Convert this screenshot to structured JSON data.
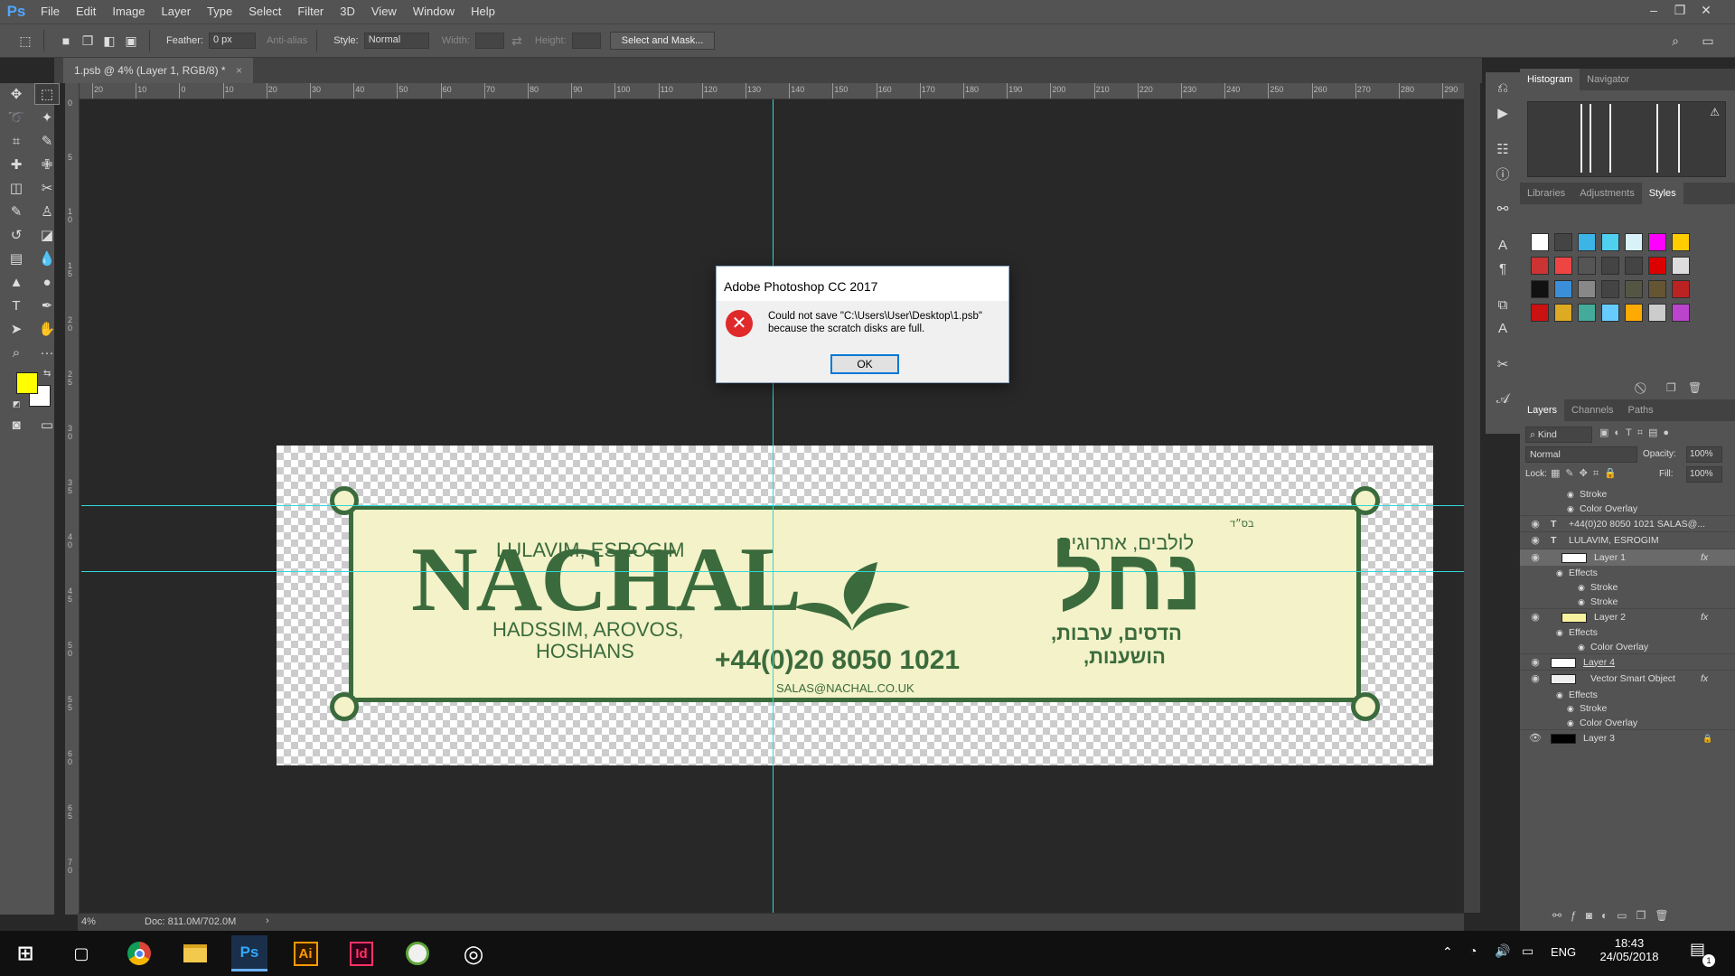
{
  "menubar": {
    "logo": "Ps",
    "items": [
      "File",
      "Edit",
      "Image",
      "Layer",
      "Type",
      "Select",
      "Filter",
      "3D",
      "View",
      "Window",
      "Help"
    ]
  },
  "options": {
    "feather_label": "Feather:",
    "feather_value": "0 px",
    "antialias_label": "Anti-alias",
    "style_label": "Style:",
    "style_value": "Normal",
    "width_label": "Width:",
    "height_label": "Height:",
    "select_mask_label": "Select and Mask..."
  },
  "document": {
    "tab_title": "1.psb @ 4% (Layer 1, RGB/8) *",
    "zoom": "4%",
    "doc_size": "Doc: 811.0M/702.0M",
    "ruler_top": [
      "20",
      "10",
      "0",
      "10",
      "20",
      "30",
      "40",
      "50",
      "60",
      "70",
      "80",
      "90",
      "100",
      "110",
      "120",
      "130",
      "140",
      "150",
      "160",
      "170",
      "180",
      "190",
      "200",
      "210",
      "220",
      "230",
      "240",
      "250",
      "260",
      "270",
      "280",
      "290"
    ],
    "ruler_left": [
      "0",
      "5",
      "1 0",
      "1 5",
      "2 0",
      "2 5",
      "3 0",
      "3 5",
      "4 0",
      "4 5",
      "5 0",
      "5 5",
      "6 0",
      "6 5",
      "7 0"
    ]
  },
  "artwork": {
    "english_top": "LULAVIM, ESROGIM",
    "brand_en": "NACHAL",
    "english_bottom_1": "HADSSIM, AROVOS,",
    "english_bottom_2": "HOSHANS",
    "phone": "+44(0)20 8050 1021",
    "email": "SALAS@NACHAL.CO.UK",
    "brand_he": "נחל",
    "hebrew_top": "לולבים, אתרוגים",
    "hebrew_bottom_1": "הדסים, ערבות,",
    "hebrew_bottom_2": "הושענות,",
    "bsd": "בס״ד",
    "colors": {
      "banner_fill": "#f3f2c8",
      "banner_green": "#3b6b3d"
    }
  },
  "dialog": {
    "title": "Adobe Photoshop CC 2017",
    "message_1": "Could not save \"C:\\Users\\User\\Desktop\\1.psb\"",
    "message_2": "because the scratch disks are full.",
    "ok_label": "OK",
    "icon": "error-icon"
  },
  "panels": {
    "top_tabs": [
      "Histogram",
      "Navigator"
    ],
    "mid_tabs": [
      "Libraries",
      "Adjustments",
      "Styles"
    ],
    "layer_tabs": [
      "Layers",
      "Channels",
      "Paths"
    ],
    "kind_label": "Kind",
    "blend_mode": "Normal",
    "opacity_label": "Opacity:",
    "opacity_value": "100%",
    "lock_label": "Lock:",
    "fill_label": "Fill:",
    "fill_value": "100%"
  },
  "layers": [
    {
      "name": "Stroke",
      "type": "effect",
      "indent": 2
    },
    {
      "name": "Color Overlay",
      "type": "effect",
      "indent": 2
    },
    {
      "name": "+44(0)20 8050 1021 SALAS@...",
      "type": "text"
    },
    {
      "name": "LULAVIM, ESROGIM",
      "type": "text"
    },
    {
      "name": "Layer 1",
      "type": "pixel",
      "fx": "fx",
      "selected": true
    },
    {
      "name": "Effects",
      "type": "effect-head",
      "indent": 1
    },
    {
      "name": "Stroke",
      "type": "effect",
      "indent": 3
    },
    {
      "name": "Stroke",
      "type": "effect",
      "indent": 3
    },
    {
      "name": "Layer 2",
      "type": "pixel",
      "fx": "fx"
    },
    {
      "name": "Effects",
      "type": "effect-head",
      "indent": 1
    },
    {
      "name": "Color Overlay",
      "type": "effect",
      "indent": 3
    },
    {
      "name": "Layer 4",
      "type": "pixel"
    },
    {
      "name": "Vector Smart Object",
      "type": "smart",
      "fx": "fx"
    },
    {
      "name": "Effects",
      "type": "effect-head",
      "indent": 1
    },
    {
      "name": "Stroke",
      "type": "effect",
      "indent": 2
    },
    {
      "name": "Color Overlay",
      "type": "effect",
      "indent": 2
    },
    {
      "name": "Layer 3",
      "type": "pixel"
    }
  ],
  "taskbar": {
    "time": "18:43",
    "date": "24/05/2018",
    "lang": "ENG",
    "apps": [
      "start-icon",
      "task-view-icon",
      "chrome-icon",
      "file-explorer-icon",
      "photoshop-icon",
      "illustrator-icon",
      "indesign-icon",
      "app-icon",
      "app-icon-2"
    ],
    "ps_label": "Ps",
    "ai_label": "Ai",
    "id_label": "Id",
    "notif_count": "1"
  },
  "colors": {
    "foreground": "#ffff00",
    "background": "#ffffff"
  }
}
